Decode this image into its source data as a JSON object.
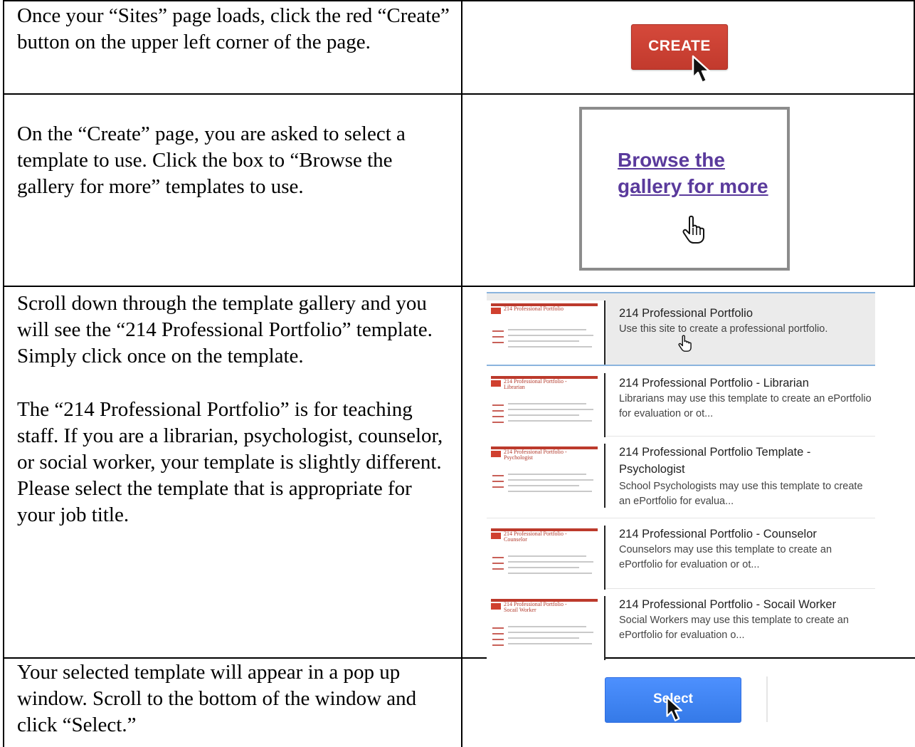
{
  "rows": [
    {
      "text": [
        "Once your “Sites” page loads, click the red “Create” button on the upper left corner of the page."
      ],
      "button_label": "CREATE"
    },
    {
      "text": [
        "On the “Create” page, you are asked to select a template to use. Click the box to “Browse the gallery for more” templates to use."
      ],
      "link_label": "Browse the gallery for more"
    },
    {
      "text": [
        "Scroll down through the template gallery and you will see the “214 Professional Portfolio” template. Simply click once on the template.",
        "The “214 Professional Portfolio” is for teaching staff. If you are a librarian, psychologist, counselor, or social worker, your template is slightly different. Please select the template that is appropriate for your job title."
      ],
      "templates": [
        {
          "title": "214 Professional Portfolio",
          "description": "Use this site to create a professional portfolio.",
          "thumb_title": "214 Professional Portfolio",
          "selected": true
        },
        {
          "title": "214 Professional Portfolio - Librarian",
          "description": "Librarians may use this template to create an ePortfolio for evaluation or ot...",
          "thumb_title": "214 Professional Portfolio - Librarian",
          "selected": false
        },
        {
          "title": "214 Professional Portfolio Template - Psychologist",
          "description": "School Psychologists may use this template to create an ePortfolio for evalua...",
          "thumb_title": "214 Professional Portfolio - Psychologist",
          "selected": false
        },
        {
          "title": "214 Professional Portfolio - Counselor",
          "description": "Counselors may use this template to create an ePortfolio for evaluation or ot...",
          "thumb_title": "214 Professional Portfolio - Counselor",
          "selected": false
        },
        {
          "title": "214 Professional Portfolio - Socail Worker",
          "description": "Social Workers may use this template to create an ePortfolio for evaluation o...",
          "thumb_title": "214 Professional Portfolio - Socail Worker",
          "selected": false
        }
      ]
    },
    {
      "text": [
        "Your selected template will appear in a pop up window. Scroll to the bottom of the window and click “Select.”"
      ],
      "button_label": "Select"
    }
  ],
  "colors": {
    "create_button": "#c9402f",
    "select_button": "#4387fd",
    "link": "#5a3a9c",
    "selected_border": "#8bb4de"
  },
  "icons": [
    "arrow-cursor-icon",
    "hand-cursor-icon"
  ]
}
